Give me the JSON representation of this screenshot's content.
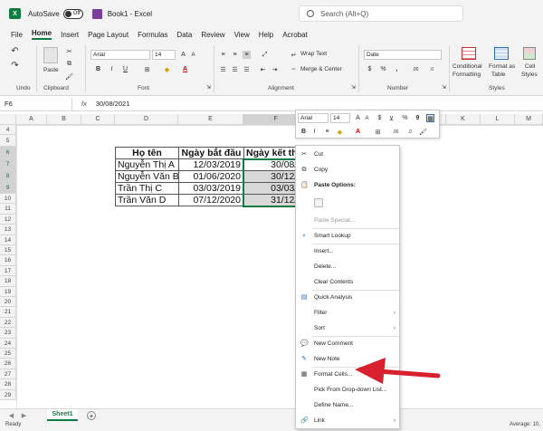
{
  "titlebar": {
    "autosave": "AutoSave",
    "toggle": "Off",
    "title": "Book1 - Excel",
    "search_placeholder": "Search (Alt+Q)"
  },
  "menu": [
    "File",
    "Home",
    "Insert",
    "Page Layout",
    "Formulas",
    "Data",
    "Review",
    "View",
    "Help",
    "Acrobat"
  ],
  "ribbon": {
    "undo_label": "Undo",
    "paste_label": "Paste",
    "clipboard_label": "Clipboard",
    "font_name": "Arial",
    "font_size": "14",
    "font_label": "Font",
    "wrap_text": "Wrap Text",
    "merge_center": "Merge & Center",
    "alignment_label": "Alignment",
    "number_format": "Date",
    "number_label": "Number",
    "conditional_formatting_1": "Conditional",
    "conditional_formatting_2": "Formatting",
    "format_table_1": "Format as",
    "format_table_2": "Table",
    "cell_styles_1": "Cell",
    "cell_styles_2": "Styles",
    "styles_label": "Styles"
  },
  "formula_bar": {
    "name_box": "F6",
    "fx": "fx",
    "value": "30/08/2021"
  },
  "columns": [
    "A",
    "B",
    "C",
    "D",
    "E",
    "F",
    "G",
    "H",
    "I",
    "J",
    "K",
    "L",
    "M"
  ],
  "rows": [
    "4",
    "5",
    "6",
    "7",
    "8",
    "9",
    "10",
    "11",
    "12",
    "13",
    "14",
    "15",
    "16",
    "17",
    "18",
    "19",
    "20",
    "21",
    "22",
    "23",
    "24",
    "25",
    "26",
    "27",
    "28",
    "29"
  ],
  "table": {
    "headers": [
      "Họ tên",
      "Ngày bắt đầu",
      "Ngày kết th"
    ],
    "rows": [
      [
        "Nguyễn Thị A",
        "12/03/2019",
        "30/08/20"
      ],
      [
        "Nguyễn Văn B",
        "01/06/2020",
        "30/12/20"
      ],
      [
        "Trần Thị C",
        "03/03/2019",
        "03/03/20"
      ],
      [
        "Trần Văn D",
        "07/12/2020",
        "31/12/20"
      ]
    ]
  },
  "mini_toolbar": {
    "font_name": "Arial",
    "font_size": "14"
  },
  "context_menu": {
    "cut": "Cut",
    "copy": "Copy",
    "paste_options": "Paste Options:",
    "paste_special": "Paste Special...",
    "smart_lookup": "Smart Lookup",
    "insert": "Insert...",
    "delete": "Delete...",
    "clear_contents": "Clear Contents",
    "quick_analysis": "Quick Analysis",
    "filter": "Filter",
    "sort": "Sort",
    "new_comment": "New Comment",
    "new_note": "New Note",
    "format_cells": "Format Cells...",
    "pick_dropdown": "Pick From Drop-down List...",
    "define_name": "Define Name...",
    "link": "Link"
  },
  "sheet_tab": "Sheet1",
  "status": {
    "left": "Ready",
    "right": "Average: 10,"
  },
  "colors": {
    "excel_green": "#107c41",
    "annotation_red": "#d9202f"
  }
}
